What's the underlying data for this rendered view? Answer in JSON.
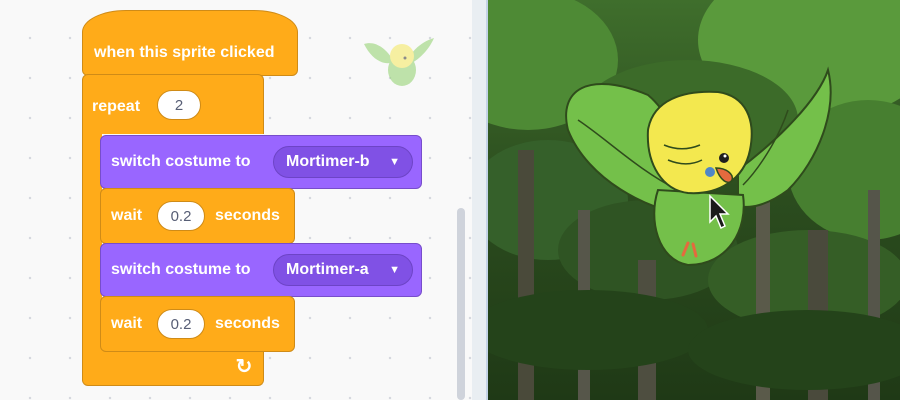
{
  "script": {
    "hat_label": "when this sprite clicked",
    "repeat_label": "repeat",
    "repeat_count": "2",
    "blocks": [
      {
        "label": "switch costume to",
        "costume": "Mortimer-b"
      },
      {
        "label": "wait",
        "value": "0.2",
        "suffix": "seconds"
      },
      {
        "label": "switch costume to",
        "costume": "Mortimer-a"
      },
      {
        "label": "wait",
        "value": "0.2",
        "suffix": "seconds"
      }
    ]
  },
  "icons": {
    "dropdown": "caret-down-icon",
    "loop": "loop-arrow-icon",
    "cursor": "mouse-pointer-icon"
  },
  "colors": {
    "events": "#ffab19",
    "control": "#ffab19",
    "looks": "#9966ff",
    "looks_dropdown": "#8051e5"
  },
  "stage": {
    "sprite": "Mortimer"
  }
}
